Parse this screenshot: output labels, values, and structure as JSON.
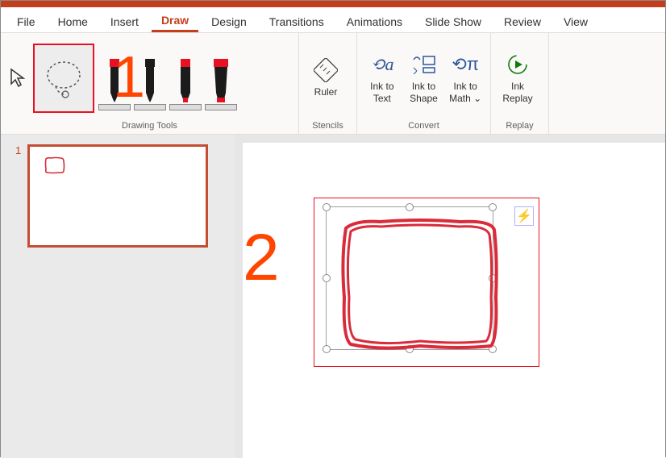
{
  "tabs": {
    "file": "File",
    "home": "Home",
    "insert": "Insert",
    "draw": "Draw",
    "design": "Design",
    "transitions": "Transitions",
    "animations": "Animations",
    "slideshow": "Slide Show",
    "review": "Review",
    "view": "View"
  },
  "ribbon": {
    "drawing_tools_label": "Drawing Tools",
    "stencils_label": "Stencils",
    "convert_label": "Convert",
    "replay_label": "Replay",
    "ruler": "Ruler",
    "ink_to_text": "Ink to\nText",
    "ink_to_shape": "Ink to\nShape",
    "ink_to_math": "Ink to\nMath ⌄",
    "ink_replay": "Ink\nReplay"
  },
  "annotations": {
    "one": "1",
    "two": "2"
  },
  "thumb": {
    "num": "1"
  },
  "colors": {
    "accent": "#c43e1c",
    "highlight": "#e81123",
    "annotation": "#ff4500",
    "ink": "#d92b3a"
  }
}
